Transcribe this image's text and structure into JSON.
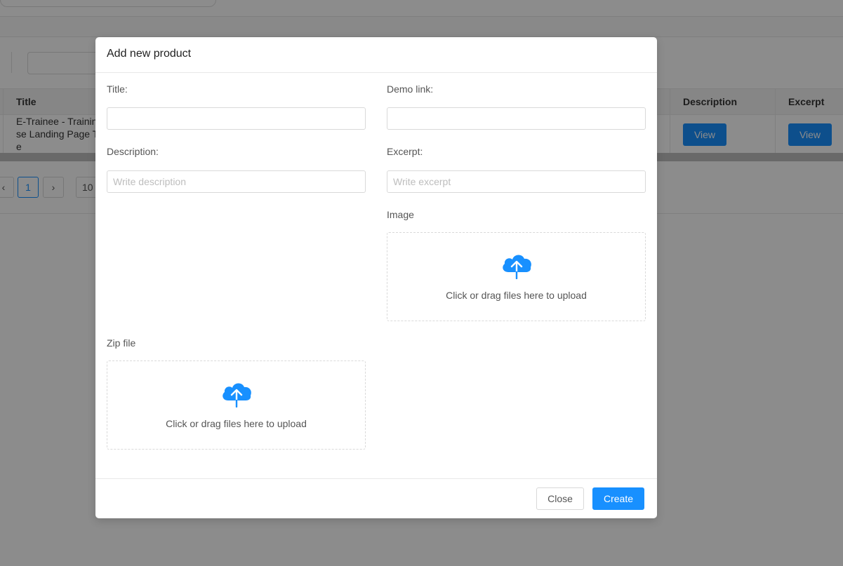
{
  "background": {
    "table": {
      "headers": {
        "title": "Title",
        "description": "Description",
        "excerpt": "Excerpt"
      },
      "row": {
        "title_lines": [
          "E-Trainee - Trainin",
          "se Landing Page T",
          "e"
        ],
        "description_button": "View",
        "excerpt_button": "View"
      }
    },
    "pagination": {
      "prev": "‹",
      "current": "1",
      "next": "›",
      "page_size": "10"
    }
  },
  "modal": {
    "title": "Add new product",
    "fields": {
      "title": {
        "label": "Title:",
        "value": "",
        "placeholder": ""
      },
      "demo_link": {
        "label": "Demo link:",
        "value": "",
        "placeholder": ""
      },
      "description": {
        "label": "Description:",
        "value": "",
        "placeholder": "Write description"
      },
      "excerpt": {
        "label": "Excerpt:",
        "value": "",
        "placeholder": "Write excerpt"
      }
    },
    "image_upload": {
      "label": "Image",
      "text": "Click or drag files here to upload",
      "icon": "cloud-upload-icon"
    },
    "zip_upload": {
      "label": "Zip file",
      "text": "Click or drag files here to upload",
      "icon": "cloud-upload-icon"
    },
    "footer": {
      "close_label": "Close",
      "create_label": "Create"
    }
  },
  "colors": {
    "primary": "#1890ff",
    "overlay": "rgba(0,0,0,0.45)"
  }
}
